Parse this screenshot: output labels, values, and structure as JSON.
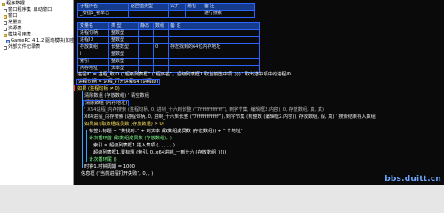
{
  "tree": {
    "items": [
      {
        "label": "程序数据",
        "icon": "folder-icon"
      },
      {
        "label": "窗口程序集_启动窗口",
        "icon": "doc-icon"
      },
      {
        "label": "窗口",
        "icon": "folder-icon"
      },
      {
        "label": "常量表",
        "icon": "doc-icon"
      },
      {
        "label": "资源表",
        "icon": "doc-icon"
      },
      {
        "label": "模块引用表",
        "icon": "folder-icon"
      },
      {
        "label": "GameRC 4.1.2 驱动模块(加密版)",
        "icon": "module-icon"
      },
      {
        "label": "外部文件记录表",
        "icon": "doc-icon"
      }
    ]
  },
  "sub_table": {
    "headers": [
      "子程序名",
      "返回值类型",
      "公开",
      "易包",
      "备 注"
    ],
    "row": {
      "name": "_按钮1_被单击",
      "note": "进行搜索"
    }
  },
  "var_table": {
    "headers": [
      "变量名",
      "类 型",
      "静态",
      "数组",
      "备 注"
    ],
    "rows": [
      {
        "name": "进程句柄",
        "type": "整数型",
        "static": "",
        "array": "",
        "note": ""
      },
      {
        "name": "进程ID",
        "type": "整数型",
        "static": "",
        "array": "",
        "note": ""
      },
      {
        "name": "存放数组",
        "type": "长整数型",
        "static": "",
        "array": "0",
        "note": "存放找到的64位内存地址"
      },
      {
        "name": "i",
        "type": "整数型",
        "static": "",
        "array": "",
        "note": ""
      },
      {
        "name": "索引",
        "type": "整数型",
        "static": "",
        "array": "",
        "note": ""
      },
      {
        "name": "内存地址",
        "type": "文本型",
        "static": "",
        "array": "",
        "note": ""
      }
    ]
  },
  "code": {
    "lines": [
      {
        "text": "进程ID = 进程_取ID (“超级列表框” (“程序名”，超级列表框1.取当前选中项 ())) ‘ 取出选中项中的进程ID",
        "color": "#ffffff"
      },
      {
        "text": "进程句柄 = 进程_打开进程64 (进程ID)",
        "color": "#ffffff"
      },
      {
        "text": "如果 (进程句柄 ≠ 0)",
        "color": "#ffe55a"
      },
      {
        "text": "清除数组 (存放数组) ‘ 清空数组",
        "color": "#e6e6e6"
      },
      {
        "text": "清除数组 (内存地址)",
        "color": "#e6e6e6"
      },
      {
        "text": "‘ X64进程_内存搜索 (进程句柄, 0, 进制_十六到长整 (“7ffffffffffffff”), 到字节集 (编辑框2.内容), 0, 存放数组, 真, 真)",
        "color": "#b7b7b7"
      },
      {
        "text": "X64进程_内存搜索 (进程句柄, 0, 进制_十六到长整 (“7ffffffffffffff”), 到字节集 (到整数 (编辑框2.内容)), 存放数组, 假, 真) ‘ 搜索结果存入数组",
        "color": "#e6e6e6"
      },
      {
        "text": "如果真 (取数组成员数 (存放数组) > 0)",
        "color": "#ffe55a"
      },
      {
        "text": "标签1.标题 = “共找到：” + 到文本 (取数组成员数 (存放数组)) + “ 个地址”",
        "color": "#ffffff"
      },
      {
        "text": "计次循环首 (取数组成员数 (存放数组), i)",
        "color": "#7cfd8a"
      },
      {
        "text": "索引 = 超级列表框1.插入表项 (, , , , , )",
        "color": "#ffffff"
      },
      {
        "text": "超级列表框1.置标题 (索引, 0, x64进制_十到十六 (存放数组 [i]))",
        "color": "#ffffff"
      },
      {
        "text": "计次循环尾 ()",
        "color": "#7cfd8a"
      },
      {
        "text": "时钟1.时钟周期 = 1000",
        "color": "#ffffff"
      },
      {
        "text": "信息框 (“当前进程打开失败”, 0, , )",
        "color": "#ffffff"
      }
    ]
  },
  "watermark": "bbs.duitt.cn"
}
